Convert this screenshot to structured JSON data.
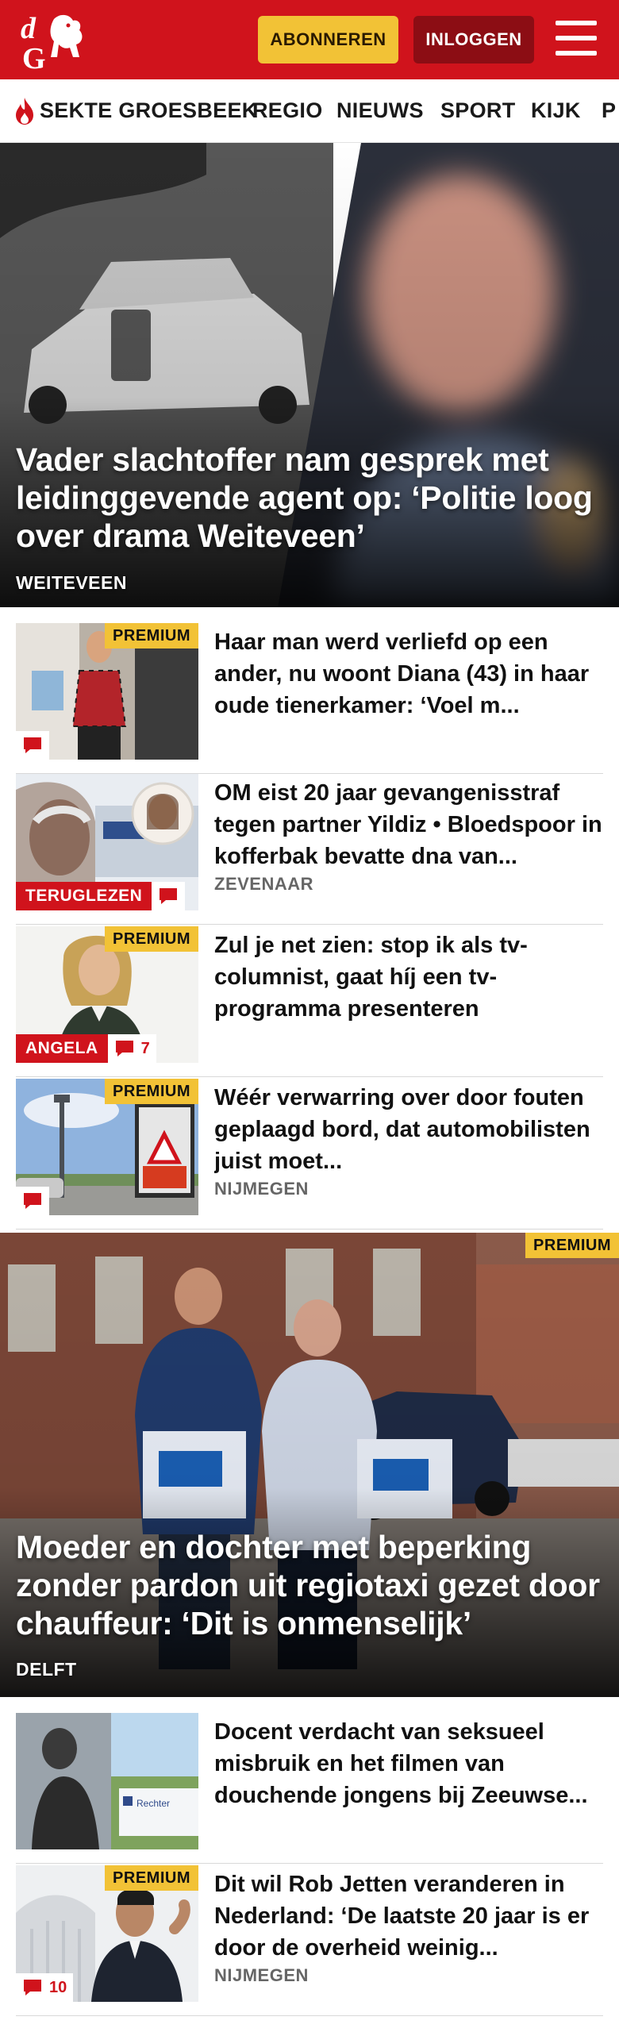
{
  "header": {
    "logo_text": "dG",
    "subscribe_label": "ABONNEREN",
    "login_label": "INLOGGEN",
    "colors": {
      "brand_red": "#d0131c",
      "premium_yellow": "#f2c236",
      "login_dark_red": "#8c0d14"
    }
  },
  "nav": {
    "items": [
      {
        "label": "SEKTE GROESBEEK",
        "icon": "flame-icon"
      },
      {
        "label": "REGIO"
      },
      {
        "label": "NIEUWS"
      },
      {
        "label": "SPORT"
      },
      {
        "label": "KIJK"
      },
      {
        "label": "P"
      }
    ]
  },
  "hero1": {
    "title": "Vader slachtoffer nam gesprek met leidinggevende agent op: ‘Politie loog over drama Weiteveen’",
    "location": "WEITEVEEN"
  },
  "articles1": [
    {
      "title": "Haar man werd verliefd op een ander, nu woont Diana (43) in haar oude tienerkamer: ‘Voel m...",
      "premium": "PREMIUM",
      "comments": ""
    },
    {
      "title": "OM eist 20 jaar gevangenisstraf tegen partner Yildiz • Bloedspoor in kofferbak bevatte dna van...",
      "location": "ZEVENAAR",
      "label": "TERUGLEZEN",
      "comments": ""
    },
    {
      "title": "Zul je net zien: stop ik als tv-columnist, gaat híj een tv-programma presenteren",
      "premium": "PREMIUM",
      "label": "ANGELA",
      "comments": "7"
    },
    {
      "title": "Wéér verwarring over door fouten geplaagd bord, dat automobilisten juist moet...",
      "location": "NIJMEGEN",
      "premium": "PREMIUM",
      "comments": ""
    }
  ],
  "hero2": {
    "title": "Moeder en dochter met beperking zonder pardon uit regiotaxi gezet door chauffeur: ‘Dit is onmenselijk’",
    "location": "DELFT",
    "premium": "PREMIUM"
  },
  "articles2": [
    {
      "title": "Docent verdacht van seksueel misbruik en het filmen van douchende jongens bij Zeeuwse...",
      "sign_text": "Rechter"
    },
    {
      "title": "Dit wil Rob Jetten veranderen in Nederland: ‘De laatste 20 jaar is er door de overheid weinig...",
      "location": "NIJMEGEN",
      "premium": "PREMIUM",
      "comments": "10"
    }
  ]
}
